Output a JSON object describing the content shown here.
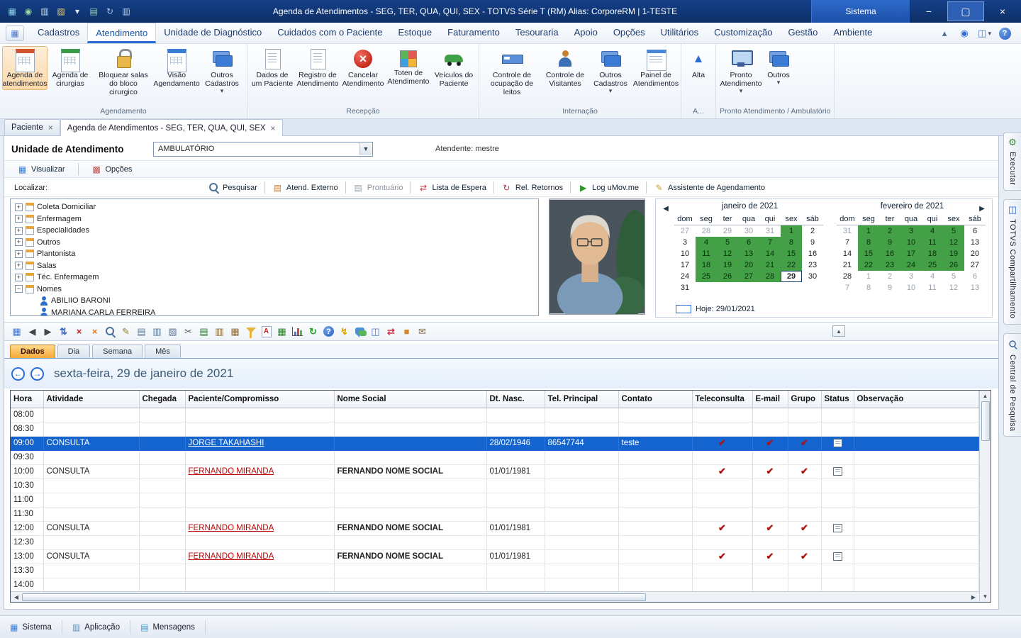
{
  "colors": {
    "titlebar_blue": "#0d2f66",
    "accent_blue": "#2a6cd5",
    "selected_row_blue": "#1464d0",
    "calendar_workday_green": "#43a047",
    "active_tab_orange": "#f5a93b",
    "patient_link_red": "#c00000",
    "checkmark_red": "#b01010"
  },
  "titlebar": {
    "title": "Agenda de Atendimentos - SEG, TER, QUA, QUI, SEX - TOTVS Série T  (RM) Alias: CorporeRM | 1-TESTE",
    "sistema": "Sistema",
    "quick_icons": [
      {
        "name": "app-window",
        "glyph": "▦",
        "color": "#8fd4ea"
      },
      {
        "name": "globe",
        "glyph": "◉",
        "color": "#9fd49f"
      },
      {
        "name": "save",
        "glyph": "▥",
        "color": "#cfe0f0"
      },
      {
        "name": "open-folder",
        "glyph": "▨",
        "color": "#e8c87a"
      },
      {
        "name": "chevron-down",
        "glyph": "▾",
        "color": "#dfe8f4"
      },
      {
        "name": "export",
        "glyph": "▤",
        "color": "#9fd4b8"
      },
      {
        "name": "refresh",
        "glyph": "↻",
        "color": "#aac8ee"
      },
      {
        "name": "copy",
        "glyph": "▥",
        "color": "#bcd2ea"
      }
    ],
    "window_buttons": {
      "minimize": "−",
      "maximize": "▢",
      "close": "×"
    }
  },
  "menubar": {
    "tabs": [
      "Cadastros",
      "Atendimento",
      "Unidade de Diagnóstico",
      "Cuidados com o Paciente",
      "Estoque",
      "Faturamento",
      "Tesouraria",
      "Apoio",
      "Opções",
      "Utilitários",
      "Customização",
      "Gestão",
      "Ambiente"
    ],
    "active_tab": "Atendimento",
    "right_icons": [
      {
        "name": "collapse-ribbon",
        "glyph": "▴",
        "color": "#4a6f9a"
      },
      {
        "name": "web-globe",
        "glyph": "◉",
        "color": "#2a6cd5"
      },
      {
        "name": "layout-selector",
        "glyph": "◫",
        "color": "#4a76c9",
        "dropdown": true
      },
      {
        "name": "help",
        "glyph": "?",
        "circle": true
      }
    ]
  },
  "ribbon": {
    "groups": [
      {
        "label": "Agendamento",
        "buttons": [
          {
            "label": "Agenda de atendimentos",
            "icon": "calendar-red",
            "active": true
          },
          {
            "label": "Agenda de cirurgias",
            "icon": "calendar-green"
          },
          {
            "label": "Bloquear salas do bloco cirurgico",
            "icon": "lock"
          },
          {
            "label": "Visão Agendamento",
            "icon": "calendar-blue"
          },
          {
            "label": "Outros Cadastros",
            "icon": "folders",
            "dropdown": true
          }
        ]
      },
      {
        "label": "Recepção",
        "buttons": [
          {
            "label": "Dados de um Paciente",
            "icon": "document"
          },
          {
            "label": "Registro de Atendimento",
            "icon": "document"
          },
          {
            "label": "Cancelar Atendimento",
            "icon": "cancel"
          },
          {
            "label": "Toten de Atendimento",
            "icon": "grid4"
          },
          {
            "label": "Veículos do Paciente",
            "icon": "car"
          }
        ]
      },
      {
        "label": "Internação",
        "buttons": [
          {
            "label": "Controle de ocupação de leitos",
            "icon": "bed"
          },
          {
            "label": "Controle de Visitantes",
            "icon": "person"
          },
          {
            "label": "Outros Cadastros",
            "icon": "folders",
            "dropdown": true
          },
          {
            "label": "Painel de Atendimentos",
            "icon": "panel"
          }
        ]
      },
      {
        "label": "A...",
        "buttons": [
          {
            "label": "Alta",
            "icon": "alta"
          }
        ]
      },
      {
        "label": "Pronto Atendimento / Ambulatório",
        "buttons": [
          {
            "label": "Pronto Atendimento",
            "icon": "monitor",
            "dropdown": true
          },
          {
            "label": "Outros",
            "icon": "folders",
            "dropdown": true
          }
        ]
      }
    ]
  },
  "doc_tabs": [
    {
      "label": "Paciente"
    },
    {
      "label": "Agenda de Atendimentos - SEG, TER, QUA, QUI, SEX",
      "active": true
    }
  ],
  "content": {
    "unidade_label": "Unidade de Atendimento",
    "unidade_value": "AMBULATÓRIO",
    "atendente": "Atendente: mestre",
    "view_buttons": [
      {
        "label": "Visualizar",
        "glyph": "▦",
        "color": "#3a7bd5"
      },
      {
        "label": "Opções",
        "glyph": "▩",
        "color": "#c0504d"
      }
    ],
    "localizar_label": "Localizar:",
    "localizar_buttons": [
      {
        "label": "Pesquisar",
        "type": "mag"
      },
      {
        "label": "Atend. Externo",
        "glyph": "▤",
        "color": "#dd7722"
      },
      {
        "label": "Prontuário",
        "glyph": "▤",
        "color": "#9aa4b0",
        "disabled": true
      },
      {
        "label": "Lista de Espera",
        "glyph": "⇄",
        "color": "#cc3344"
      },
      {
        "label": "Rel. Retornos",
        "glyph": "↻",
        "color": "#cc3344"
      },
      {
        "label": "Log uMov.me",
        "glyph": "▶",
        "color": "#2a9a2a"
      },
      {
        "label": "Assistente de Agendamento",
        "glyph": "✎",
        "color": "#caa22a"
      }
    ]
  },
  "tree": {
    "items": [
      {
        "label": "Coleta Domiciliar",
        "level": 0,
        "expander": "plus",
        "icon": "category"
      },
      {
        "label": "Enfermagem",
        "level": 0,
        "expander": "plus",
        "icon": "category"
      },
      {
        "label": "Especialidades",
        "level": 0,
        "expander": "plus",
        "icon": "category"
      },
      {
        "label": "Outros",
        "level": 0,
        "expander": "plus",
        "icon": "category"
      },
      {
        "label": "Plantonista",
        "level": 0,
        "expander": "plus",
        "icon": "category"
      },
      {
        "label": "Salas",
        "level": 0,
        "expander": "plus",
        "icon": "category"
      },
      {
        "label": "Téc. Enfermagem",
        "level": 0,
        "expander": "plus",
        "icon": "category"
      },
      {
        "label": "Nomes",
        "level": 0,
        "expander": "minus",
        "icon": "category"
      },
      {
        "label": "ABILIIO BARONI",
        "level": 1,
        "expander": "none",
        "icon": "person"
      },
      {
        "label": "MARIANA CARLA FERREIRA",
        "level": 1,
        "expander": "none",
        "icon": "person"
      }
    ]
  },
  "calendar": {
    "day_headers": [
      "dom",
      "seg",
      "ter",
      "qua",
      "qui",
      "sex",
      "sáb"
    ],
    "months": [
      {
        "title": "janeiro de 2021",
        "weeks": [
          [
            {
              "n": 27,
              "s": "out"
            },
            {
              "n": 28,
              "s": "out"
            },
            {
              "n": 29,
              "s": "out"
            },
            {
              "n": 30,
              "s": "out"
            },
            {
              "n": 31,
              "s": "out"
            },
            {
              "n": 1,
              "s": "work"
            },
            {
              "n": 2,
              "s": "plain"
            }
          ],
          [
            {
              "n": 3,
              "s": "plain"
            },
            {
              "n": 4,
              "s": "work"
            },
            {
              "n": 5,
              "s": "work"
            },
            {
              "n": 6,
              "s": "work"
            },
            {
              "n": 7,
              "s": "work"
            },
            {
              "n": 8,
              "s": "work"
            },
            {
              "n": 9,
              "s": "plain"
            }
          ],
          [
            {
              "n": 10,
              "s": "plain"
            },
            {
              "n": 11,
              "s": "work"
            },
            {
              "n": 12,
              "s": "work"
            },
            {
              "n": 13,
              "s": "work"
            },
            {
              "n": 14,
              "s": "work"
            },
            {
              "n": 15,
              "s": "work"
            },
            {
              "n": 16,
              "s": "plain"
            }
          ],
          [
            {
              "n": 17,
              "s": "plain"
            },
            {
              "n": 18,
              "s": "work"
            },
            {
              "n": 19,
              "s": "work"
            },
            {
              "n": 20,
              "s": "work"
            },
            {
              "n": 21,
              "s": "work"
            },
            {
              "n": 22,
              "s": "work"
            },
            {
              "n": 23,
              "s": "plain"
            }
          ],
          [
            {
              "n": 24,
              "s": "plain"
            },
            {
              "n": 25,
              "s": "work"
            },
            {
              "n": 26,
              "s": "work"
            },
            {
              "n": 27,
              "s": "work"
            },
            {
              "n": 28,
              "s": "work"
            },
            {
              "n": 29,
              "s": "today"
            },
            {
              "n": 30,
              "s": "plain"
            }
          ],
          [
            {
              "n": 31,
              "s": "plain"
            },
            null,
            null,
            null,
            null,
            null,
            null
          ]
        ]
      },
      {
        "title": "fevereiro de 2021",
        "weeks": [
          [
            {
              "n": 31,
              "s": "out"
            },
            {
              "n": 1,
              "s": "work"
            },
            {
              "n": 2,
              "s": "work"
            },
            {
              "n": 3,
              "s": "work"
            },
            {
              "n": 4,
              "s": "work"
            },
            {
              "n": 5,
              "s": "work"
            },
            {
              "n": 6,
              "s": "plain"
            }
          ],
          [
            {
              "n": 7,
              "s": "plain"
            },
            {
              "n": 8,
              "s": "work"
            },
            {
              "n": 9,
              "s": "work"
            },
            {
              "n": 10,
              "s": "work"
            },
            {
              "n": 11,
              "s": "work"
            },
            {
              "n": 12,
              "s": "work"
            },
            {
              "n": 13,
              "s": "plain"
            }
          ],
          [
            {
              "n": 14,
              "s": "plain"
            },
            {
              "n": 15,
              "s": "work"
            },
            {
              "n": 16,
              "s": "work"
            },
            {
              "n": 17,
              "s": "work"
            },
            {
              "n": 18,
              "s": "work"
            },
            {
              "n": 19,
              "s": "work"
            },
            {
              "n": 20,
              "s": "plain"
            }
          ],
          [
            {
              "n": 21,
              "s": "plain"
            },
            {
              "n": 22,
              "s": "work"
            },
            {
              "n": 23,
              "s": "work"
            },
            {
              "n": 24,
              "s": "work"
            },
            {
              "n": 25,
              "s": "work"
            },
            {
              "n": 26,
              "s": "work"
            },
            {
              "n": 27,
              "s": "plain"
            }
          ],
          [
            {
              "n": 28,
              "s": "plain"
            },
            {
              "n": 1,
              "s": "out"
            },
            {
              "n": 2,
              "s": "out"
            },
            {
              "n": 3,
              "s": "out"
            },
            {
              "n": 4,
              "s": "out"
            },
            {
              "n": 5,
              "s": "out"
            },
            {
              "n": 6,
              "s": "out"
            }
          ],
          [
            {
              "n": 7,
              "s": "out"
            },
            {
              "n": 8,
              "s": "out"
            },
            {
              "n": 9,
              "s": "out"
            },
            {
              "n": 10,
              "s": "out"
            },
            {
              "n": 11,
              "s": "out"
            },
            {
              "n": 12,
              "s": "out"
            },
            {
              "n": 13,
              "s": "out"
            }
          ]
        ]
      }
    ],
    "nav_prev": "◀",
    "nav_next": "▶",
    "today_label": "Hoje: 29/01/2021"
  },
  "action_toolbar": {
    "collapse_glyph": "▴",
    "icons": [
      {
        "name": "layout-columns",
        "glyph": "▦",
        "color": "#4a76c9"
      },
      {
        "name": "nav-previous",
        "glyph": "◀",
        "color": "#444444"
      },
      {
        "name": "nav-next",
        "glyph": "▶",
        "color": "#444444"
      },
      {
        "name": "sort",
        "glyph": "⇅",
        "color": "#2a62c9",
        "bold": true
      },
      {
        "name": "delete",
        "glyph": "×",
        "color": "#cc2222",
        "bold": true
      },
      {
        "name": "clear-search",
        "glyph": "×",
        "color": "#e07820",
        "bold": true
      },
      {
        "name": "permission-search",
        "type": "mag"
      },
      {
        "name": "edit",
        "glyph": "✎",
        "color": "#9a7b2d"
      },
      {
        "name": "copy",
        "glyph": "▤",
        "color": "#5b7a9a"
      },
      {
        "name": "copy-to",
        "glyph": "▥",
        "color": "#5b7a9a"
      },
      {
        "name": "move-to",
        "glyph": "▧",
        "color": "#5b7a9a"
      },
      {
        "name": "cut",
        "glyph": "✂",
        "color": "#555555"
      },
      {
        "name": "insert-record",
        "glyph": "▤",
        "color": "#2a7a2a"
      },
      {
        "name": "clipboard",
        "glyph": "▥",
        "color": "#8a6d3b"
      },
      {
        "name": "paste",
        "glyph": "▦",
        "color": "#8a6d3b"
      },
      {
        "name": "filter",
        "type": "funnel"
      },
      {
        "name": "export-pdf",
        "type": "pdf",
        "letter": "A"
      },
      {
        "name": "export-file",
        "glyph": "▦",
        "color": "#2a7a2a"
      },
      {
        "name": "chart",
        "type": "chart"
      },
      {
        "name": "refresh",
        "glyph": "↻",
        "color": "#2a9a2a",
        "bold": true
      },
      {
        "name": "help",
        "type": "help",
        "letter": "?"
      },
      {
        "name": "process",
        "glyph": "↯",
        "color": "#e0a000",
        "bold": true
      },
      {
        "name": "comments",
        "type": "chat"
      },
      {
        "name": "grid-columns",
        "glyph": "◫",
        "color": "#4a76c9"
      },
      {
        "name": "transfer",
        "glyph": "⇄",
        "color": "#cc3344",
        "bold": true
      },
      {
        "name": "package",
        "glyph": "■",
        "color": "#d2882a"
      },
      {
        "name": "mail",
        "glyph": "✉",
        "color": "#8a6d3b"
      }
    ]
  },
  "view_tabs": {
    "tabs": [
      "Dados",
      "Dia",
      "Semana",
      "Mês"
    ],
    "active": "Dados"
  },
  "date_nav": {
    "prev": "←",
    "next": "→",
    "label": "sexta-feira, 29 de janeiro de 2021"
  },
  "table": {
    "columns": [
      "Hora",
      "Atividade",
      "Chegada",
      "Paciente/Compromisso",
      "Nome Social",
      "Dt. Nasc.",
      "Tel. Principal",
      "Contato",
      "Teleconsulta",
      "E-mail",
      "Grupo",
      "Status",
      "Observação"
    ],
    "rows": [
      {
        "hora": "08:00"
      },
      {
        "hora": "08:30"
      },
      {
        "hora": "09:00",
        "atividade": "CONSULTA",
        "paciente": "JORGE TAKAHASHI",
        "dt_nasc": "28/02/1946",
        "tel": "86547744",
        "contato": "teste",
        "teleconsulta": true,
        "email": true,
        "grupo": true,
        "status": true,
        "selected": true
      },
      {
        "hora": "09:30"
      },
      {
        "hora": "10:00",
        "atividade": "CONSULTA",
        "paciente": "FERNANDO MIRANDA",
        "nome_social": "FERNANDO NOME SOCIAL",
        "dt_nasc": "01/01/1981",
        "teleconsulta": true,
        "email": true,
        "grupo": true,
        "status": true
      },
      {
        "hora": "10:30"
      },
      {
        "hora": "11:00"
      },
      {
        "hora": "11:30"
      },
      {
        "hora": "12:00",
        "atividade": "CONSULTA",
        "paciente": "FERNANDO MIRANDA",
        "nome_social": "FERNANDO NOME SOCIAL",
        "dt_nasc": "01/01/1981",
        "teleconsulta": true,
        "email": true,
        "grupo": true,
        "status": true
      },
      {
        "hora": "12:30"
      },
      {
        "hora": "13:00",
        "atividade": "CONSULTA",
        "paciente": "FERNANDO MIRANDA",
        "nome_social": "FERNANDO NOME SOCIAL",
        "dt_nasc": "01/01/1981",
        "teleconsulta": true,
        "email": true,
        "grupo": true,
        "status": true
      },
      {
        "hora": "13:30"
      },
      {
        "hora": "14:00"
      }
    ]
  },
  "statusbar": {
    "items": [
      {
        "label": "Sistema",
        "glyph": "▦",
        "color": "#3a7bd5"
      },
      {
        "label": "Aplicação",
        "glyph": "▥",
        "color": "#5b8ab5"
      },
      {
        "label": "Mensagens",
        "glyph": "▤",
        "color": "#3a9ad5"
      }
    ]
  },
  "side_tabs": [
    {
      "label": "Executar",
      "glyph": "⚙",
      "color": "#3a8a3a"
    },
    {
      "label": "TOTVS Compartilhamento",
      "glyph": "◫",
      "color": "#2a6cd5"
    },
    {
      "label": "Central de Pesquisa",
      "type": "mag"
    }
  ]
}
